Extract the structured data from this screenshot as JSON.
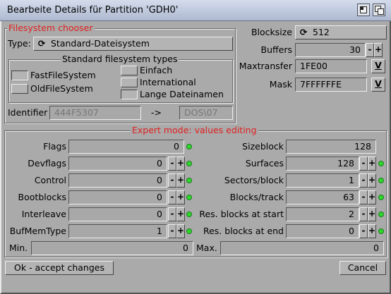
{
  "window": {
    "title": "Bearbeite Details für Partition 'GDH0'",
    "controls": [
      "iconify-icon",
      "depth-icon"
    ]
  },
  "chooser": {
    "title": "Filesystem chooser",
    "type_label": "Type:",
    "type_value": "Standard-Dateisystem",
    "std_title": "Standard filesystem types",
    "options": [
      {
        "label": "FastFileSystem",
        "checked": false
      },
      {
        "label": "OldFileSystem",
        "checked": true
      },
      {
        "label": "Einfach",
        "checked": true
      },
      {
        "label": "International",
        "checked": true
      },
      {
        "label": "Lange Dateinamen",
        "checked": false
      }
    ],
    "identifier_label": "Identifier",
    "identifier_value": "444F5307",
    "arrow": "->",
    "dos_value": "DOS\\07"
  },
  "right": {
    "blocksize_label": "Blocksize",
    "blocksize_value": "512",
    "buffers_label": "Buffers",
    "buffers_value": "30",
    "maxtransfer_label": "Maxtransfer",
    "maxtransfer_value": "1FE00",
    "mask_label": "Mask",
    "mask_value": "7FFFFFFE",
    "v_button": "V"
  },
  "expert": {
    "title": "Expert mode: values editing",
    "left": [
      {
        "label": "Flags",
        "value": "0",
        "stepper": false
      },
      {
        "label": "Devflags",
        "value": "0",
        "stepper": true
      },
      {
        "label": "Control",
        "value": "0",
        "stepper": true
      },
      {
        "label": "Bootblocks",
        "value": "0",
        "stepper": true
      },
      {
        "label": "Interleave",
        "value": "0",
        "stepper": true
      },
      {
        "label": "BufMemType",
        "value": "1",
        "stepper": true
      }
    ],
    "right": [
      {
        "label": "Sizeblock",
        "value": "128",
        "stepper": false,
        "dot": false
      },
      {
        "label": "Surfaces",
        "value": "128",
        "stepper": true,
        "dot": true
      },
      {
        "label": "Sectors/block",
        "value": "1",
        "stepper": true,
        "dot": true
      },
      {
        "label": "Blocks/track",
        "value": "63",
        "stepper": true,
        "dot": true
      },
      {
        "label": "Res. blocks at start",
        "value": "2",
        "stepper": true,
        "dot": true
      },
      {
        "label": "Res. blocks at end",
        "value": "0",
        "stepper": true,
        "dot": true
      }
    ],
    "min_label": "Min.",
    "min_value": "0",
    "max_label": "Max.",
    "max_value": "0",
    "minus": "-",
    "plus": "+"
  },
  "footer": {
    "ok_label": "Ok - accept changes",
    "cancel_label": "Cancel"
  }
}
